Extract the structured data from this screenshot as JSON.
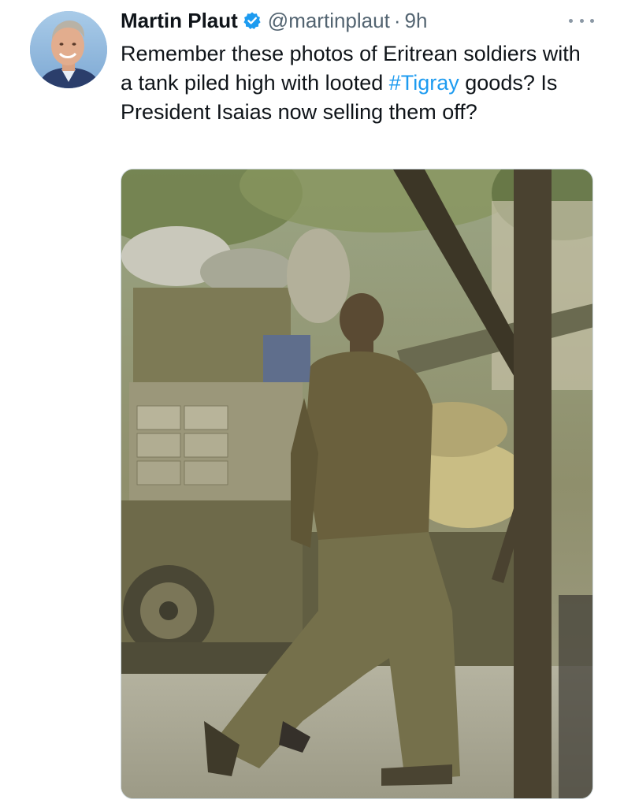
{
  "tweet": {
    "author_name": "Martin Plaut",
    "handle": "@martinplaut",
    "separator": "·",
    "time": "9h",
    "text_before": "Remember these photos of Eritrean soldiers with a tank piled high with looted ",
    "hashtag": "#Tigray",
    "text_after": " goods? Is President Isaias now selling them off?",
    "verified": true
  },
  "icons": {
    "verified": "verified-badge-icon",
    "more": "more-options-icon"
  },
  "colors": {
    "text": "#0f1419",
    "secondary": "#536471",
    "link": "#1d9bf0"
  }
}
